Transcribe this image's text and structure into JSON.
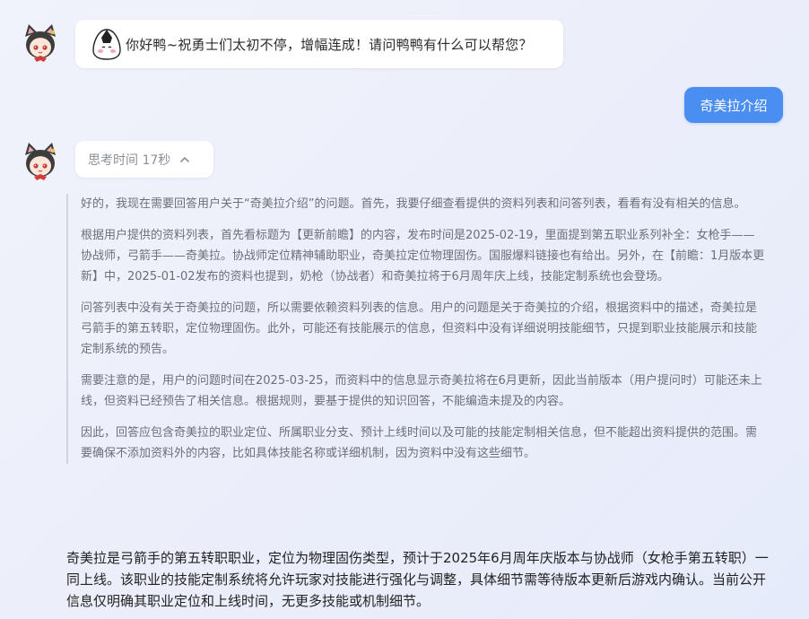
{
  "conversation": {
    "greeting": {
      "avatar_icon": "cat-girl-avatar-icon",
      "emoji_icon": "rice-ball-emoji-icon",
      "text": "你好鸭~祝勇士们太初不停，增幅连成！请问鸭鸭有什么可以帮您？"
    },
    "user_message": {
      "text": "奇美拉介绍",
      "color": "#4b8ef2"
    },
    "response": {
      "avatar_icon": "cat-girl-avatar-icon",
      "thinking_toggle": {
        "label": "思考时间 17秒",
        "icon": "chevron-up-icon"
      },
      "reasoning_paragraphs": [
        "好的，我现在需要回答用户关于“奇美拉介绍”的问题。首先，我要仔细查看提供的资料列表和问答列表，看看有没有相关的信息。",
        "根据用户提供的资料列表，首先看标题为【更新前瞻】的内容，发布时间是2025-02-19，里面提到第五职业系列补全：女枪手——协战师，弓箭手——奇美拉。协战师定位精神辅助职业，奇美拉定位物理固伤。国服爆料链接也有给出。另外，在【前瞻：1月版本更新】中，2025-01-02发布的资料也提到，奶枪（协战者）和奇美拉将于6月周年庆上线，技能定制系统也会登场。",
        "问答列表中没有关于奇美拉的问题，所以需要依赖资料列表的信息。用户的问题是关于奇美拉的介绍，根据资料中的描述，奇美拉是弓箭手的第五转职，定位物理固伤。此外，可能还有技能展示的信息，但资料中没有详细说明技能细节，只提到职业技能展示和技能定制系统的预告。",
        "需要注意的是，用户的问题时间在2025-03-25，而资料中的信息显示奇美拉将在6月更新，因此当前版本（用户提问时）可能还未上线，但资料已经预告了相关信息。根据规则，要基于提供的知识回答，不能编造未提及的内容。",
        "因此，回答应包含奇美拉的职业定位、所属职业分支、预计上线时间以及可能的技能定制相关信息，但不能超出资料提供的范围。需要确保不添加资料外的内容，比如具体技能名称或详细机制，因为资料中没有这些细节。"
      ],
      "answer": "奇美拉是弓箭手的第五转职职业，定位为物理固伤类型，预计于2025年6月周年庆版本与协战师（女枪手第五转职）一同上线。该职业的技能定制系统将允许玩家对技能进行强化与调整，具体细节需等待版本更新后游戏内确认。当前公开信息仅明确其职业定位和上线时间，无更多技能或机制细节。"
    }
  }
}
